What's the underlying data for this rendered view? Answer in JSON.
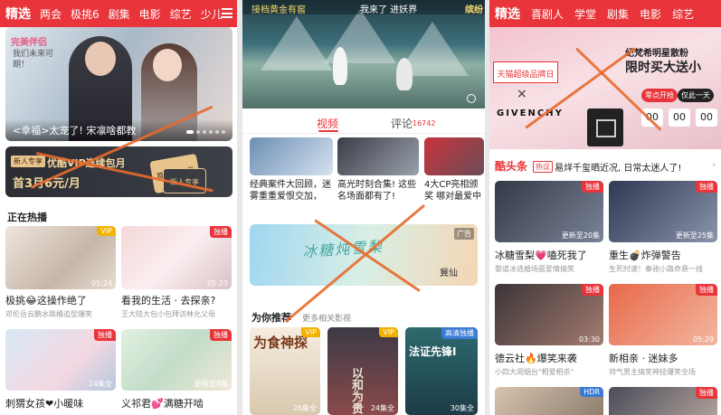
{
  "screen1": {
    "nav_tabs": [
      "精选",
      "两会",
      "极挑6",
      "剧集",
      "电影",
      "综艺",
      "少儿"
    ],
    "hero": {
      "logo": "完美伴侣",
      "slogan": "我们未来可期！",
      "caption": "<幸福>太宠了! 宋凛啥都教"
    },
    "vip_banner": {
      "tag": "新人专享",
      "headline": "优酷VIP连续包月",
      "price_line": "首3月6元/月",
      "card_text": "首3月6元月",
      "card_sub": "新人专享"
    },
    "section_title": "正在热播",
    "items": [
      {
        "title": "极挑😂这操作绝了",
        "sub": "邓伦岳云鹏水跳桶追型爆笑",
        "badge": "VIP",
        "badge_type": "vip",
        "duration": "05:24"
      },
      {
        "title": "看我的生活 · 去探亲?",
        "sub": "王大陆大包小包拜访林允父母",
        "badge": "独播",
        "badge_type": "red",
        "duration": "05:23"
      },
      {
        "title": "刺猬女孩❤小暖味",
        "sub": "",
        "badge": "独播",
        "badge_type": "red",
        "duration": "24集全"
      },
      {
        "title": "义祁君💕满糖开啮",
        "sub": "",
        "badge": "独播",
        "badge_type": "red",
        "duration": "更新至8集"
      }
    ]
  },
  "screen2": {
    "video": {
      "left_text": "接档黄金有窖",
      "center_text": "我来了 进妖界",
      "right_text": "缤纷"
    },
    "tabs": {
      "video": "视频",
      "comments": "评论",
      "comment_count": "16742"
    },
    "cards": [
      {
        "title": "经典案件大回顾，迷雾重重爱恨交加，",
        "poster": ""
      },
      {
        "title": "高光时刻合集! 这些名场面都有了!",
        "poster": ""
      },
      {
        "title": "4大CP亮相颁奖 哪对最爱中你?",
        "poster": ""
      }
    ],
    "ad": {
      "title": "冰糖炖雪梨",
      "tag": "广告",
      "brand": "冀仙"
    },
    "recommend": {
      "title": "为你推荐",
      "more": "更多相关影视"
    },
    "posters": [
      {
        "text": "为食神探",
        "badge": "VIP",
        "badge_type": "vip",
        "duration": "26集全"
      },
      {
        "text": "以和为贵",
        "badge": "VIP",
        "badge_type": "vip",
        "duration": "24集全"
      },
      {
        "text": "法证先锋I",
        "badge": "高清独播",
        "badge_type": "blue",
        "duration": "30集全"
      }
    ]
  },
  "screen3": {
    "nav_tabs": [
      "精选",
      "喜剧人",
      "学堂",
      "剧集",
      "电影",
      "综艺"
    ],
    "hero": {
      "label": "天猫超级品牌日",
      "x": "×",
      "brand": "GIVENCHY",
      "line1": "纪梵希明星散粉",
      "line2": "限时买大送小",
      "pill1": "零点开抢",
      "pill2": "仅此一天",
      "countdown": [
        "00",
        "00",
        "00"
      ]
    },
    "headline_section": {
      "title": "酷头条",
      "tag": "热议",
      "text": "易烊千玺晒近况, 日常太迷人了!",
      "more": "›"
    },
    "items": [
      {
        "title": "冰糖雪梨💗嗑死我了",
        "sub": "黎道冰逃婚场面爱情搞笑",
        "badge": "独播",
        "badge_type": "red",
        "duration": "更新至20集"
      },
      {
        "title": "重生💣炸弹警告",
        "sub": "生死时速！秦驰小路命悬一线",
        "badge": "独播",
        "badge_type": "red",
        "duration": "更新至25集"
      },
      {
        "title": "德云社🔥爆笑来袭",
        "sub": "小四大闹烟台\"相爱相杀\"",
        "badge": "独播",
        "badge_type": "red",
        "duration": "03:30"
      },
      {
        "title": "新相亲 · 迷妹多",
        "sub": "帅气男主搞笑神技爆笑全场",
        "badge": "独播",
        "badge_type": "red",
        "duration": "05:29"
      },
      {
        "title": "",
        "sub": "",
        "badge": "HDR",
        "badge_type": "blue",
        "duration": ""
      },
      {
        "title": "",
        "sub": "",
        "badge": "独播",
        "badge_type": "red",
        "duration": ""
      }
    ]
  },
  "colors": {
    "brand_red": "#e8343a",
    "vip_gold": "#f2b300",
    "cross_orange": "#e86a2c"
  },
  "icons": {
    "menu": "menu-icon",
    "play": "play-icon"
  }
}
